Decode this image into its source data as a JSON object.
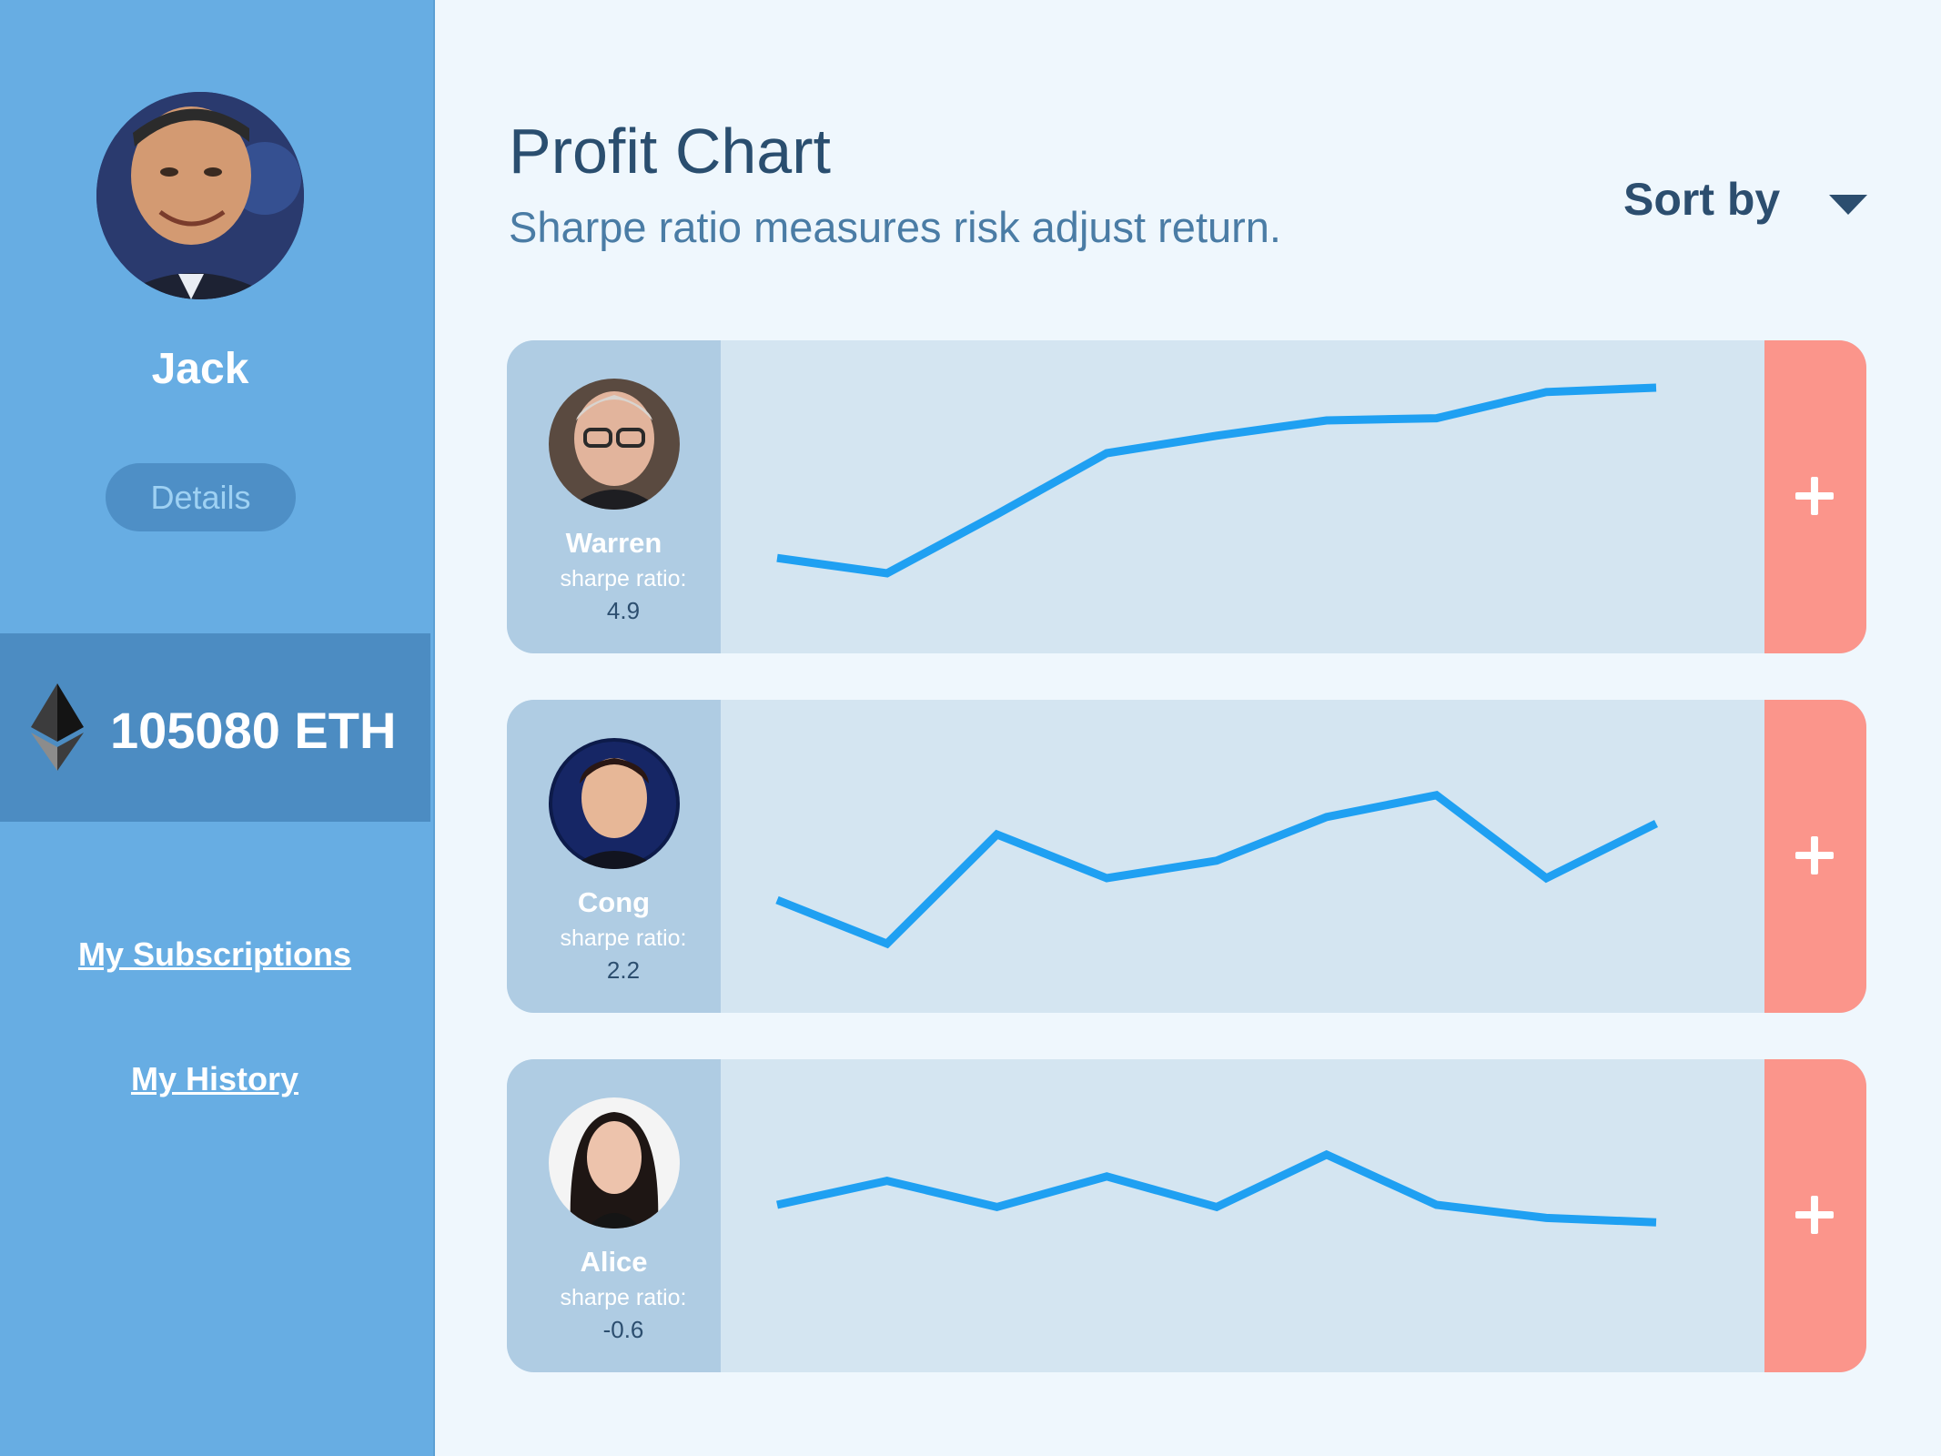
{
  "sidebar": {
    "user": {
      "name": "Jack",
      "avatar_icon": "user-portrait"
    },
    "details_label": "Details",
    "wallet": {
      "icon": "ethereum-icon",
      "amount": "105080 ETH"
    },
    "links": [
      {
        "label": "My Subscriptions"
      },
      {
        "label": "My History"
      }
    ]
  },
  "header": {
    "title": "Profit Chart",
    "subtitle": "Sharpe ratio measures risk adjust return.",
    "sort_label": "Sort by"
  },
  "colors": {
    "sidebar_bg": "#67ade3",
    "wallet_bg": "#4c8cc2",
    "line": "#1fa0f2",
    "add_button": "#fb958b",
    "card_bg": "#d4e5f1",
    "card_left_bg": "#afcce3"
  },
  "cards": [
    {
      "name": "Warren",
      "ratio_label": "sharpe ratio:",
      "ratio_value": "4.9",
      "add_icon": "plus-icon",
      "series": [
        0.22,
        0.15,
        0.42,
        0.7,
        0.78,
        0.85,
        0.86,
        0.98,
        1.0
      ]
    },
    {
      "name": "Cong",
      "ratio_label": "sharpe ratio:",
      "ratio_value": "2.2",
      "add_icon": "plus-icon",
      "series": [
        0.3,
        0.1,
        0.6,
        0.4,
        0.48,
        0.68,
        0.78,
        0.4,
        0.65
      ]
    },
    {
      "name": "Alice",
      "ratio_label": "sharpe ratio:",
      "ratio_value": "-0.6",
      "add_icon": "plus-icon",
      "series": [
        0.55,
        0.66,
        0.54,
        0.68,
        0.54,
        0.78,
        0.55,
        0.49,
        0.47
      ]
    }
  ]
}
